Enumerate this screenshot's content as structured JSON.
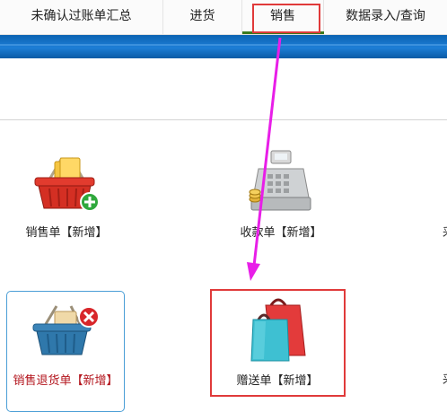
{
  "tabs": [
    {
      "label": "未确认过账单汇总"
    },
    {
      "label": "进货"
    },
    {
      "label": "销售"
    },
    {
      "label": "数据录入/查询"
    }
  ],
  "active_tab_index": 2,
  "tiles": {
    "sales_order": {
      "label": "销售单【新增】",
      "icon": "shopping-basket-add-icon"
    },
    "receipt_order": {
      "label": "收款单【新增】",
      "icon": "cash-register-icon"
    },
    "sales_return": {
      "label": "销售退货单【新增】",
      "icon": "shopping-basket-remove-icon"
    },
    "gift_order": {
      "label": "赠送单【新增】",
      "icon": "shopping-bags-icon"
    }
  },
  "edge_glyphs": [
    "采",
    "采"
  ],
  "colors": {
    "accent_blue": "#1d7ed6",
    "annotation_red": "#e03a3a",
    "arrow_magenta": "#e81ee8",
    "return_label_red": "#b3141c"
  }
}
